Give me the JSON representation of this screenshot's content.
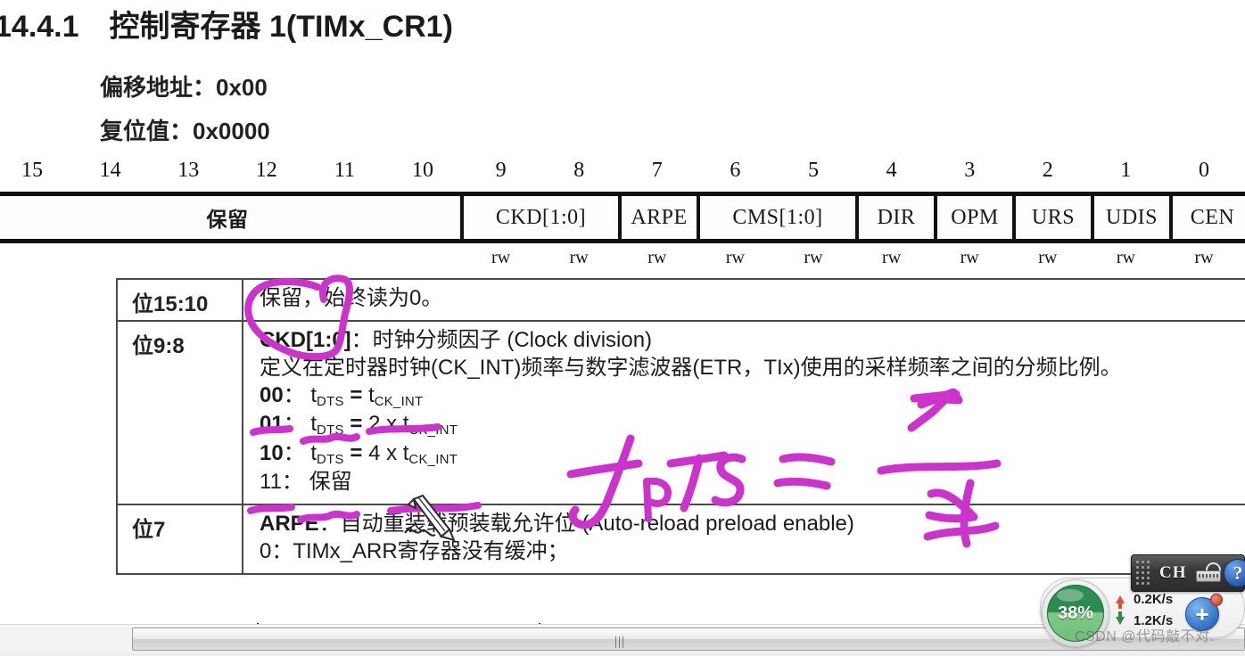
{
  "document": {
    "section_number": "14.4.1",
    "section_title": "控制寄存器 1(TIMx_CR1)",
    "offset_label": "偏移地址：0x00",
    "reset_label": "复位值：0x0000"
  },
  "bit_table": {
    "bit_numbers": [
      "15",
      "14",
      "13",
      "12",
      "11",
      "10",
      "9",
      "8",
      "7",
      "6",
      "5",
      "4",
      "3",
      "2",
      "1",
      "0"
    ],
    "fields": [
      {
        "name": "保留",
        "bits": "15:10",
        "access": ""
      },
      {
        "name": "CKD[1:0]",
        "bits": "9:8",
        "access": "rw"
      },
      {
        "name": "ARPE",
        "bits": "7",
        "access": "rw"
      },
      {
        "name": "CMS[1:0]",
        "bits": "6:5",
        "access": "rw"
      },
      {
        "name": "DIR",
        "bits": "4",
        "access": "rw"
      },
      {
        "name": "OPM",
        "bits": "3",
        "access": "rw"
      },
      {
        "name": "URS",
        "bits": "2",
        "access": "rw"
      },
      {
        "name": "UDIS",
        "bits": "1",
        "access": "rw"
      },
      {
        "name": "CEN",
        "bits": "0",
        "access": "rw"
      }
    ],
    "access_labels": [
      "rw",
      "rw",
      "rw",
      "rw",
      "rw",
      "rw",
      "rw",
      "rw",
      "rw",
      "rw"
    ]
  },
  "description_table": {
    "rows": [
      {
        "bit_label": "位15:10",
        "text": "保留，始终读为0。"
      },
      {
        "bit_label": "位9:8",
        "field_name": "CKD[1:0]",
        "field_desc": "：时钟分频因子 (Clock division)",
        "detail": "定义在定时器时钟(CK_INT)频率与数字滤波器(ETR，TIx)使用的采样频率之间的分频比例。",
        "options": [
          {
            "code": "00",
            "sep": "：",
            "expr_pre": "t",
            "expr_sub": "DTS",
            "eq": " = ",
            "mult": "",
            "rhs_pre": "t",
            "rhs_sub": "CK_INT"
          },
          {
            "code": "01",
            "sep": "：",
            "expr_pre": "t",
            "expr_sub": "DTS",
            "eq": " = ",
            "mult": "2 x ",
            "rhs_pre": "t",
            "rhs_sub": "CK_INT"
          },
          {
            "code": "10",
            "sep": "：",
            "expr_pre": "t",
            "expr_sub": "DTS",
            "eq": " = ",
            "mult": "4 x ",
            "rhs_pre": "t",
            "rhs_sub": "CK_INT"
          },
          {
            "code": "11",
            "sep": "：",
            "reserved_text": "保留"
          }
        ]
      },
      {
        "bit_label": "位7",
        "field_name": "ARPE",
        "field_desc": "：自动重装载预装载允许位 (Auto-reload preload enable)",
        "detail": "0：TIMx_ARR寄存器没有缓冲；"
      }
    ]
  },
  "annotations": {
    "ink_color": "#cc33cc",
    "handwriting_text": "f DTS = 1/4",
    "circled_field": "CKD[1:0]",
    "underlined_items": [
      "00",
      "tDTS",
      "tCK_INT",
      "10",
      "4 x tCK_INT"
    ]
  },
  "overlay": {
    "cpu_gauge": {
      "value": "38%",
      "fill_color": "#2e8f52"
    },
    "network": {
      "upload": "0.2K/s",
      "download": "1.2K/s",
      "upload_color": "#d4553a",
      "download_color": "#2f8a4a"
    },
    "plus_button_label": "+",
    "ime": {
      "language": "CH",
      "help_label": "?"
    },
    "watermark": "CSDN @代码敲不对."
  },
  "scrollbar": {
    "grip": "|||",
    "orientation": "horizontal"
  }
}
